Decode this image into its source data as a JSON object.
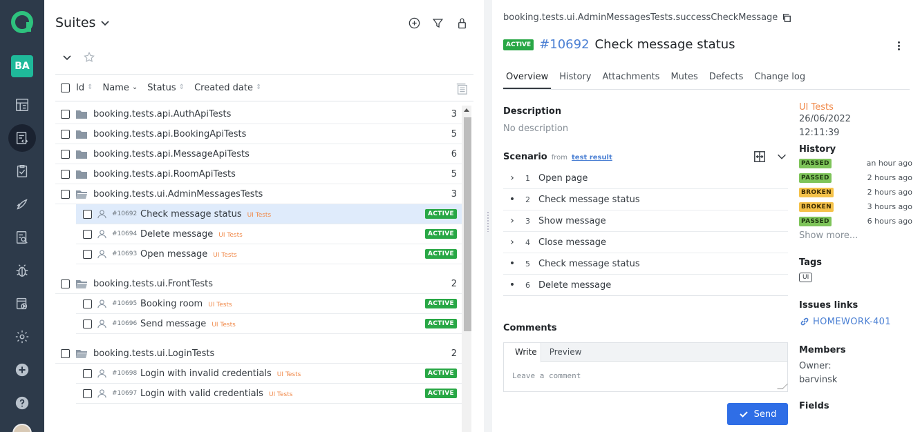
{
  "nav": {
    "avatar_initials": "BA",
    "items": [
      "dashboard-icon",
      "repository-icon",
      "test-plans-icon",
      "launches-icon",
      "analytics-icon",
      "defects-icon",
      "jobs-icon",
      "settings-icon",
      "add-icon",
      "help-icon"
    ]
  },
  "tree": {
    "title": "Suites",
    "columns": {
      "id": "Id",
      "name": "Name",
      "status": "Status",
      "created": "Created date"
    },
    "folders": [
      {
        "name": "booking.tests.api.AuthApiTests",
        "count": "3"
      },
      {
        "name": "booking.tests.api.BookingApiTests",
        "count": "5"
      },
      {
        "name": "booking.tests.api.MessageApiTests",
        "count": "6"
      },
      {
        "name": "booking.tests.api.RoomApiTests",
        "count": "5"
      },
      {
        "name": "booking.tests.ui.AdminMessagesTests",
        "count": "3"
      },
      {
        "name": "booking.tests.ui.FrontTests",
        "count": "2"
      },
      {
        "name": "booking.tests.ui.LoginTests",
        "count": "2"
      }
    ],
    "cases": [
      {
        "id": "#10692",
        "name": "Check message status",
        "tag": "UI Tests",
        "status": "ACTIVE"
      },
      {
        "id": "#10694",
        "name": "Delete message",
        "tag": "UI Tests",
        "status": "ACTIVE"
      },
      {
        "id": "#10693",
        "name": "Open message",
        "tag": "UI Tests",
        "status": "ACTIVE"
      },
      {
        "id": "#10695",
        "name": "Booking room",
        "tag": "UI Tests",
        "status": "ACTIVE"
      },
      {
        "id": "#10696",
        "name": "Send message",
        "tag": "UI Tests",
        "status": "ACTIVE"
      },
      {
        "id": "#10698",
        "name": "Login with invalid credentials",
        "tag": "UI Tests",
        "status": "ACTIVE"
      },
      {
        "id": "#10697",
        "name": "Login with valid credentials",
        "tag": "UI Tests",
        "status": "ACTIVE"
      }
    ]
  },
  "detail": {
    "breadcrumb": "booking.tests.ui.AdminMessagesTests.successCheckMessage",
    "status": "ACTIVE",
    "number": "#10692",
    "title": "Check message status",
    "tabs": [
      "Overview",
      "History",
      "Attachments",
      "Mutes",
      "Defects",
      "Change log"
    ],
    "description_title": "Description",
    "description": "No description",
    "scenario_title": "Scenario",
    "scenario_from": "from",
    "scenario_link": "test result",
    "steps": [
      {
        "mark": "›",
        "num": "1",
        "name": "Open page"
      },
      {
        "mark": "•",
        "num": "2",
        "name": "Check message status"
      },
      {
        "mark": "›",
        "num": "3",
        "name": "Show message"
      },
      {
        "mark": "›",
        "num": "4",
        "name": "Close message"
      },
      {
        "mark": "•",
        "num": "5",
        "name": "Check message status"
      },
      {
        "mark": "•",
        "num": "6",
        "name": "Delete message"
      }
    ],
    "comments_title": "Comments",
    "comment_write": "Write",
    "comment_preview": "Preview",
    "comment_placeholder": "Leave a comment",
    "send_label": "Send"
  },
  "side": {
    "author": "UI Tests",
    "date": "26/06/2022",
    "time": "12:11:39",
    "history_title": "History",
    "history": [
      {
        "status": "PASSED",
        "kind": "passed",
        "time": "an hour ago"
      },
      {
        "status": "PASSED",
        "kind": "passed",
        "time": "2 hours ago"
      },
      {
        "status": "BROKEN",
        "kind": "broken",
        "time": "2 hours ago"
      },
      {
        "status": "BROKEN",
        "kind": "broken",
        "time": "3 hours ago"
      },
      {
        "status": "PASSED",
        "kind": "passed",
        "time": "6 hours ago"
      }
    ],
    "show_more": "Show more...",
    "tags_title": "Tags",
    "tag": "UI",
    "issues_title": "Issues links",
    "issue": "HOMEWORK-401",
    "members_title": "Members",
    "owner_label": "Owner:",
    "owner": "barvinsk",
    "fields_title": "Fields"
  },
  "colors": {
    "accent": "#2f6ee6",
    "active_badge": "#28a745",
    "nav_bg": "#2d3a4a",
    "tag": "#f08a4b",
    "selected_row": "#dfebfb"
  }
}
